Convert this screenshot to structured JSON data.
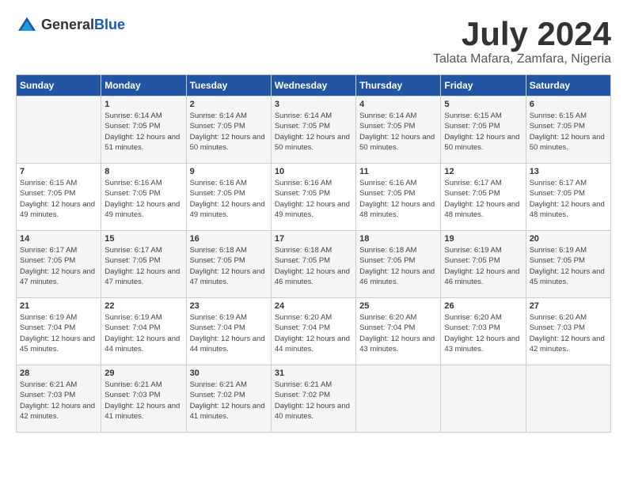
{
  "logo": {
    "text_general": "General",
    "text_blue": "Blue"
  },
  "title": {
    "month_year": "July 2024",
    "location": "Talata Mafara, Zamfara, Nigeria"
  },
  "headers": [
    "Sunday",
    "Monday",
    "Tuesday",
    "Wednesday",
    "Thursday",
    "Friday",
    "Saturday"
  ],
  "weeks": [
    [
      {
        "day": "",
        "sunrise": "",
        "sunset": "",
        "daylight": ""
      },
      {
        "day": "1",
        "sunrise": "Sunrise: 6:14 AM",
        "sunset": "Sunset: 7:05 PM",
        "daylight": "Daylight: 12 hours and 51 minutes."
      },
      {
        "day": "2",
        "sunrise": "Sunrise: 6:14 AM",
        "sunset": "Sunset: 7:05 PM",
        "daylight": "Daylight: 12 hours and 50 minutes."
      },
      {
        "day": "3",
        "sunrise": "Sunrise: 6:14 AM",
        "sunset": "Sunset: 7:05 PM",
        "daylight": "Daylight: 12 hours and 50 minutes."
      },
      {
        "day": "4",
        "sunrise": "Sunrise: 6:14 AM",
        "sunset": "Sunset: 7:05 PM",
        "daylight": "Daylight: 12 hours and 50 minutes."
      },
      {
        "day": "5",
        "sunrise": "Sunrise: 6:15 AM",
        "sunset": "Sunset: 7:05 PM",
        "daylight": "Daylight: 12 hours and 50 minutes."
      },
      {
        "day": "6",
        "sunrise": "Sunrise: 6:15 AM",
        "sunset": "Sunset: 7:05 PM",
        "daylight": "Daylight: 12 hours and 50 minutes."
      }
    ],
    [
      {
        "day": "7",
        "sunrise": "Sunrise: 6:15 AM",
        "sunset": "Sunset: 7:05 PM",
        "daylight": "Daylight: 12 hours and 49 minutes."
      },
      {
        "day": "8",
        "sunrise": "Sunrise: 6:16 AM",
        "sunset": "Sunset: 7:05 PM",
        "daylight": "Daylight: 12 hours and 49 minutes."
      },
      {
        "day": "9",
        "sunrise": "Sunrise: 6:16 AM",
        "sunset": "Sunset: 7:05 PM",
        "daylight": "Daylight: 12 hours and 49 minutes."
      },
      {
        "day": "10",
        "sunrise": "Sunrise: 6:16 AM",
        "sunset": "Sunset: 7:05 PM",
        "daylight": "Daylight: 12 hours and 49 minutes."
      },
      {
        "day": "11",
        "sunrise": "Sunrise: 6:16 AM",
        "sunset": "Sunset: 7:05 PM",
        "daylight": "Daylight: 12 hours and 48 minutes."
      },
      {
        "day": "12",
        "sunrise": "Sunrise: 6:17 AM",
        "sunset": "Sunset: 7:05 PM",
        "daylight": "Daylight: 12 hours and 48 minutes."
      },
      {
        "day": "13",
        "sunrise": "Sunrise: 6:17 AM",
        "sunset": "Sunset: 7:05 PM",
        "daylight": "Daylight: 12 hours and 48 minutes."
      }
    ],
    [
      {
        "day": "14",
        "sunrise": "Sunrise: 6:17 AM",
        "sunset": "Sunset: 7:05 PM",
        "daylight": "Daylight: 12 hours and 47 minutes."
      },
      {
        "day": "15",
        "sunrise": "Sunrise: 6:17 AM",
        "sunset": "Sunset: 7:05 PM",
        "daylight": "Daylight: 12 hours and 47 minutes."
      },
      {
        "day": "16",
        "sunrise": "Sunrise: 6:18 AM",
        "sunset": "Sunset: 7:05 PM",
        "daylight": "Daylight: 12 hours and 47 minutes."
      },
      {
        "day": "17",
        "sunrise": "Sunrise: 6:18 AM",
        "sunset": "Sunset: 7:05 PM",
        "daylight": "Daylight: 12 hours and 46 minutes."
      },
      {
        "day": "18",
        "sunrise": "Sunrise: 6:18 AM",
        "sunset": "Sunset: 7:05 PM",
        "daylight": "Daylight: 12 hours and 46 minutes."
      },
      {
        "day": "19",
        "sunrise": "Sunrise: 6:19 AM",
        "sunset": "Sunset: 7:05 PM",
        "daylight": "Daylight: 12 hours and 46 minutes."
      },
      {
        "day": "20",
        "sunrise": "Sunrise: 6:19 AM",
        "sunset": "Sunset: 7:05 PM",
        "daylight": "Daylight: 12 hours and 45 minutes."
      }
    ],
    [
      {
        "day": "21",
        "sunrise": "Sunrise: 6:19 AM",
        "sunset": "Sunset: 7:04 PM",
        "daylight": "Daylight: 12 hours and 45 minutes."
      },
      {
        "day": "22",
        "sunrise": "Sunrise: 6:19 AM",
        "sunset": "Sunset: 7:04 PM",
        "daylight": "Daylight: 12 hours and 44 minutes."
      },
      {
        "day": "23",
        "sunrise": "Sunrise: 6:19 AM",
        "sunset": "Sunset: 7:04 PM",
        "daylight": "Daylight: 12 hours and 44 minutes."
      },
      {
        "day": "24",
        "sunrise": "Sunrise: 6:20 AM",
        "sunset": "Sunset: 7:04 PM",
        "daylight": "Daylight: 12 hours and 44 minutes."
      },
      {
        "day": "25",
        "sunrise": "Sunrise: 6:20 AM",
        "sunset": "Sunset: 7:04 PM",
        "daylight": "Daylight: 12 hours and 43 minutes."
      },
      {
        "day": "26",
        "sunrise": "Sunrise: 6:20 AM",
        "sunset": "Sunset: 7:03 PM",
        "daylight": "Daylight: 12 hours and 43 minutes."
      },
      {
        "day": "27",
        "sunrise": "Sunrise: 6:20 AM",
        "sunset": "Sunset: 7:03 PM",
        "daylight": "Daylight: 12 hours and 42 minutes."
      }
    ],
    [
      {
        "day": "28",
        "sunrise": "Sunrise: 6:21 AM",
        "sunset": "Sunset: 7:03 PM",
        "daylight": "Daylight: 12 hours and 42 minutes."
      },
      {
        "day": "29",
        "sunrise": "Sunrise: 6:21 AM",
        "sunset": "Sunset: 7:03 PM",
        "daylight": "Daylight: 12 hours and 41 minutes."
      },
      {
        "day": "30",
        "sunrise": "Sunrise: 6:21 AM",
        "sunset": "Sunset: 7:02 PM",
        "daylight": "Daylight: 12 hours and 41 minutes."
      },
      {
        "day": "31",
        "sunrise": "Sunrise: 6:21 AM",
        "sunset": "Sunset: 7:02 PM",
        "daylight": "Daylight: 12 hours and 40 minutes."
      },
      {
        "day": "",
        "sunrise": "",
        "sunset": "",
        "daylight": ""
      },
      {
        "day": "",
        "sunrise": "",
        "sunset": "",
        "daylight": ""
      },
      {
        "day": "",
        "sunrise": "",
        "sunset": "",
        "daylight": ""
      }
    ]
  ]
}
